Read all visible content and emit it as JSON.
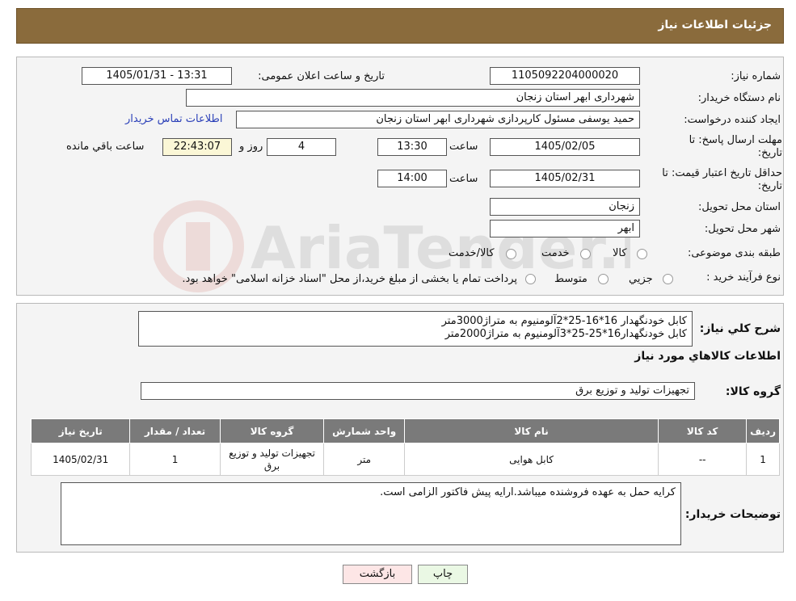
{
  "header": {
    "title": "جزئیات اطلاعات نیاز"
  },
  "form": {
    "need_number_label": "شماره نیاز:",
    "need_number": "1105092204000020",
    "announce_label": "تاریخ و ساعت اعلان عمومی:",
    "announce_value": "1405/01/31 - 13:31",
    "buyer_org_label": "نام دستگاه خریدار:",
    "buyer_org": "شهرداری ابهر استان زنجان",
    "creator_label": "ایجاد کننده درخواست:",
    "creator": "حمید یوسفی مسئول کارپردازی شهرداری ابهر استان زنجان",
    "contact_link": "اطلاعات تماس خریدار",
    "deadline_label_1": "مهلت ارسال پاسخ: تا",
    "deadline_label_2": "تاریخ:",
    "deadline_date": "1405/02/05",
    "time_label": "ساعت",
    "deadline_time": "13:30",
    "days_value": "4",
    "days_label": "روز و",
    "remaining_time": "22:43:07",
    "remaining_label": "ساعت باقي مانده",
    "validity_label_1": "حداقل تاریخ اعتبار قیمت: تا",
    "validity_label_2": "تاریخ:",
    "validity_date": "1405/02/31",
    "validity_time": "14:00",
    "province_label": "استان محل تحویل:",
    "province": "زنجان",
    "city_label": "شهر محل تحویل:",
    "city": "ابهر",
    "category_label": "طبقه بندی موضوعی:",
    "category_options": [
      "کالا",
      "خدمت",
      "کالا/خدمت"
    ],
    "process_label": "نوع فرآیند خرید :",
    "process_options": [
      "جزیي",
      "متوسط"
    ],
    "process_note": "پرداخت تمام یا بخشی از مبلغ خرید،از محل \"اسناد خزانه اسلامی\" خواهد بود."
  },
  "summary": {
    "label": "شرح كلي نياز:",
    "line1": "کابل خودنگهدار 16*16-25*2آلومنیوم به متراژ3000متر",
    "line2": "کابل خودنگهدار16*25-25*3آلومنیوم به متراژ2000متر",
    "items_title": "اطلاعات كالاهاي مورد نياز",
    "group_label": "گروه کالا:",
    "group_value": "تجهیزات تولید و توزیع برق"
  },
  "table": {
    "headers": [
      "رديف",
      "کد کالا",
      "نام کالا",
      "واحد شمارش",
      "گروه کالا",
      "تعداد / مقدار",
      "تاریخ نیاز"
    ],
    "rows": [
      [
        "1",
        "--",
        "کابل هوایی",
        "متر",
        "تجهیزات تولید و توزیع برق",
        "1",
        "1405/02/31"
      ]
    ]
  },
  "notes": {
    "label": "توضیحات خریدار:",
    "text": "کرایه حمل به عهده فروشنده میباشد.ارایه پیش فاکتور الزامی است."
  },
  "buttons": {
    "print": "چاپ",
    "back": "بازگشت"
  },
  "colors": {
    "header_bg": "#8a6b3c",
    "table_header_bg": "#7a7a7a",
    "remaining_bg": "#fbf7d6",
    "link": "#2a3fb8"
  }
}
